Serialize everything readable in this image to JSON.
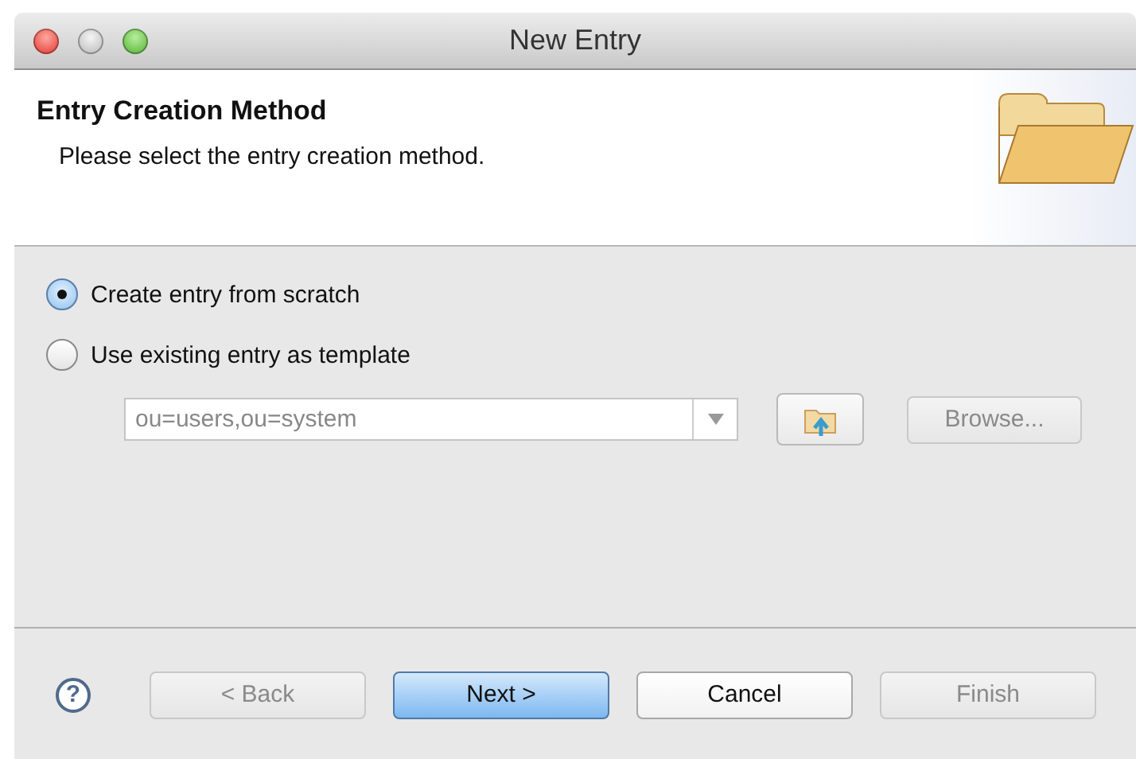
{
  "window": {
    "title": "New Entry"
  },
  "header": {
    "title": "Entry Creation Method",
    "description": "Please select the entry creation method."
  },
  "options": [
    {
      "label": "Create entry from scratch",
      "selected": true
    },
    {
      "label": "Use existing entry as template",
      "selected": false
    }
  ],
  "template_field": {
    "value": "ou=users,ou=system",
    "disabled": true
  },
  "browse_button": {
    "label": "Browse...",
    "disabled": true
  },
  "help": "?",
  "buttons": [
    {
      "label": "< Back",
      "disabled": true,
      "default": false
    },
    {
      "label": "Next >",
      "disabled": false,
      "default": true
    },
    {
      "label": "Cancel",
      "disabled": false,
      "default": false
    },
    {
      "label": "Finish",
      "disabled": true,
      "default": false
    }
  ]
}
